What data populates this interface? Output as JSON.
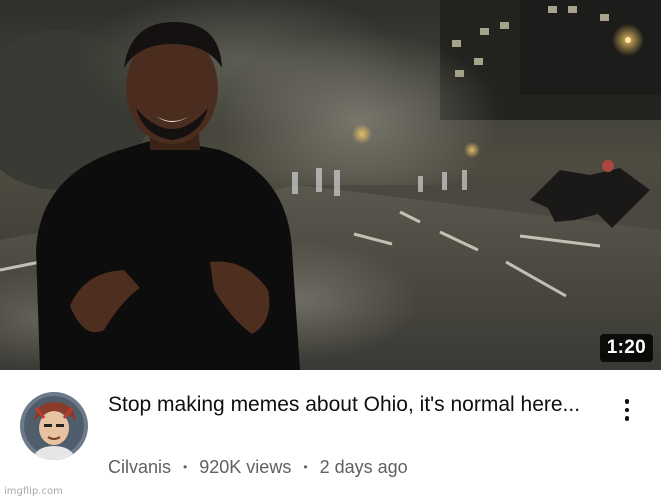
{
  "video": {
    "duration": "1:20",
    "title": "Stop making memes about Ohio, it's normal here...",
    "channel": "Cilvanis",
    "views": "920K views",
    "age": "2 days ago",
    "separator": "•"
  },
  "icons": {
    "more": "more-vert-icon",
    "avatar": "channel-avatar"
  },
  "watermark": "imgflip.com",
  "colors": {
    "title": "#0f0f0f",
    "secondary_text": "#606060",
    "duration_bg": "#000000"
  }
}
